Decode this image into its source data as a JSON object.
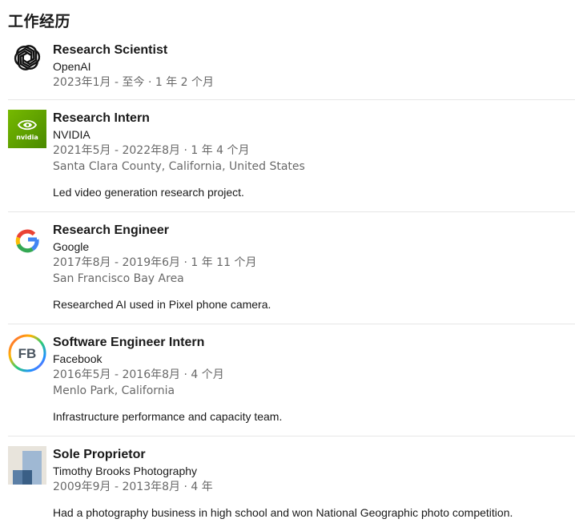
{
  "section": {
    "title": "工作经历"
  },
  "experiences": [
    {
      "logo_icon": "openai-logo-icon",
      "role": "Research Scientist",
      "company": "OpenAI",
      "dates": "2023年1月 - 至今 · 1 年 2 个月"
    },
    {
      "logo_icon": "nvidia-logo-icon",
      "logo_text": "nvidia",
      "role": "Research Intern",
      "company": "NVIDIA",
      "dates": "2021年5月 - 2022年8月 · 1 年 4 个月",
      "location": "Santa Clara County, California, United States",
      "description": "Led video generation research project."
    },
    {
      "logo_icon": "google-logo-icon",
      "logo_text": "G",
      "role": "Research Engineer",
      "company": "Google",
      "dates": "2017年8月 - 2019年6月 · 1 年 11 个月",
      "location": "San Francisco Bay Area",
      "description": "Researched AI used in Pixel phone camera."
    },
    {
      "logo_icon": "facebook-fb-logo-icon",
      "logo_text": "FB",
      "role": "Software Engineer Intern",
      "company": "Facebook",
      "dates": "2016年5月 - 2016年8月 · 4 个月",
      "location": "Menlo Park, California",
      "description": "Infrastructure performance and capacity team."
    },
    {
      "logo_icon": "photography-logo-icon",
      "role": "Sole Proprietor",
      "company": "Timothy Brooks Photography",
      "dates": "2009年9月 - 2013年8月 · 4 年",
      "description": "Had a photography business in high school and won National Geographic photo competition."
    }
  ],
  "colors": {
    "nvidia_green": "#76b900",
    "google_blue": "#4285f4",
    "google_red": "#ea4335",
    "google_yellow": "#fbbc05",
    "google_green": "#34a853",
    "divider": "#e6e6e6",
    "secondary_text": "rgba(0,0,0,0.6)"
  }
}
